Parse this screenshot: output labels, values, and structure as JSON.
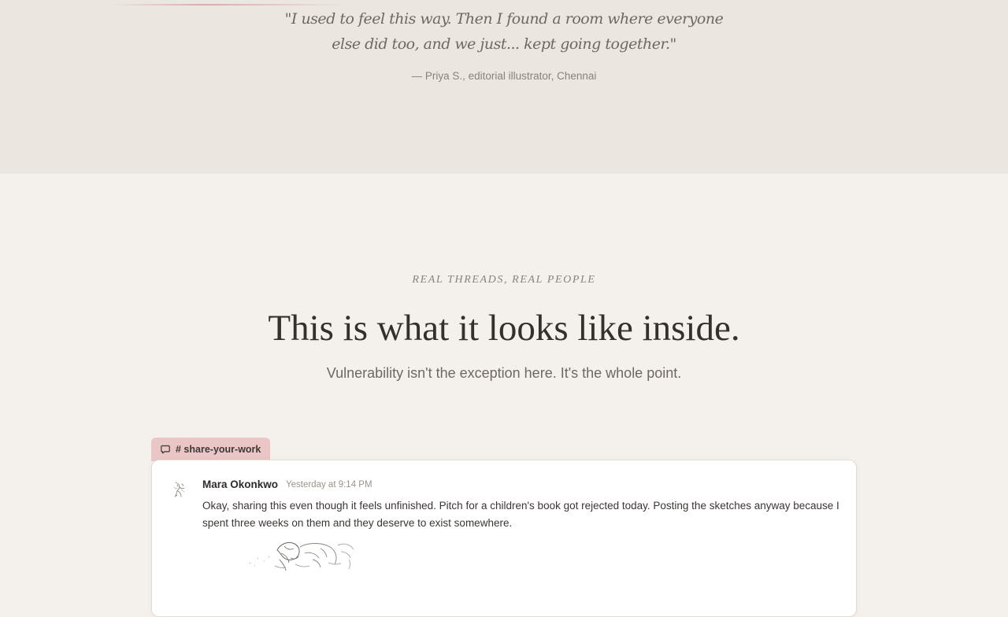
{
  "testimonial": {
    "quote_line_1": "\"I used to feel this way. Then I found a room where everyone",
    "quote_line_2": "else did too, and we just... kept going together.\"",
    "attribution": "— Priya S., editorial illustrator, Chennai"
  },
  "inside_section": {
    "eyebrow": "REAL THREADS, REAL PEOPLE",
    "headline": "This is what it looks like inside.",
    "subhead": "Vulnerability isn't the exception here. It's the whole point."
  },
  "thread": {
    "channel": "# share-your-work",
    "channel_icon": "chat-bubble-icon",
    "message": {
      "author": "Mara Okonkwo",
      "timestamp": "Yesterday at 9:14 PM",
      "text": "Okay, sharing this even though it feels unfinished. Pitch for a children's book got rejected today. Posting the sketches anyway because I spent three weeks on them and they deserve to exist somewhere."
    }
  },
  "colors": {
    "page_background": "#f4f0eb",
    "testimonial_background": "#ece6e0",
    "channel_tab": "#ebc6c6",
    "heading_text": "#34302c"
  }
}
